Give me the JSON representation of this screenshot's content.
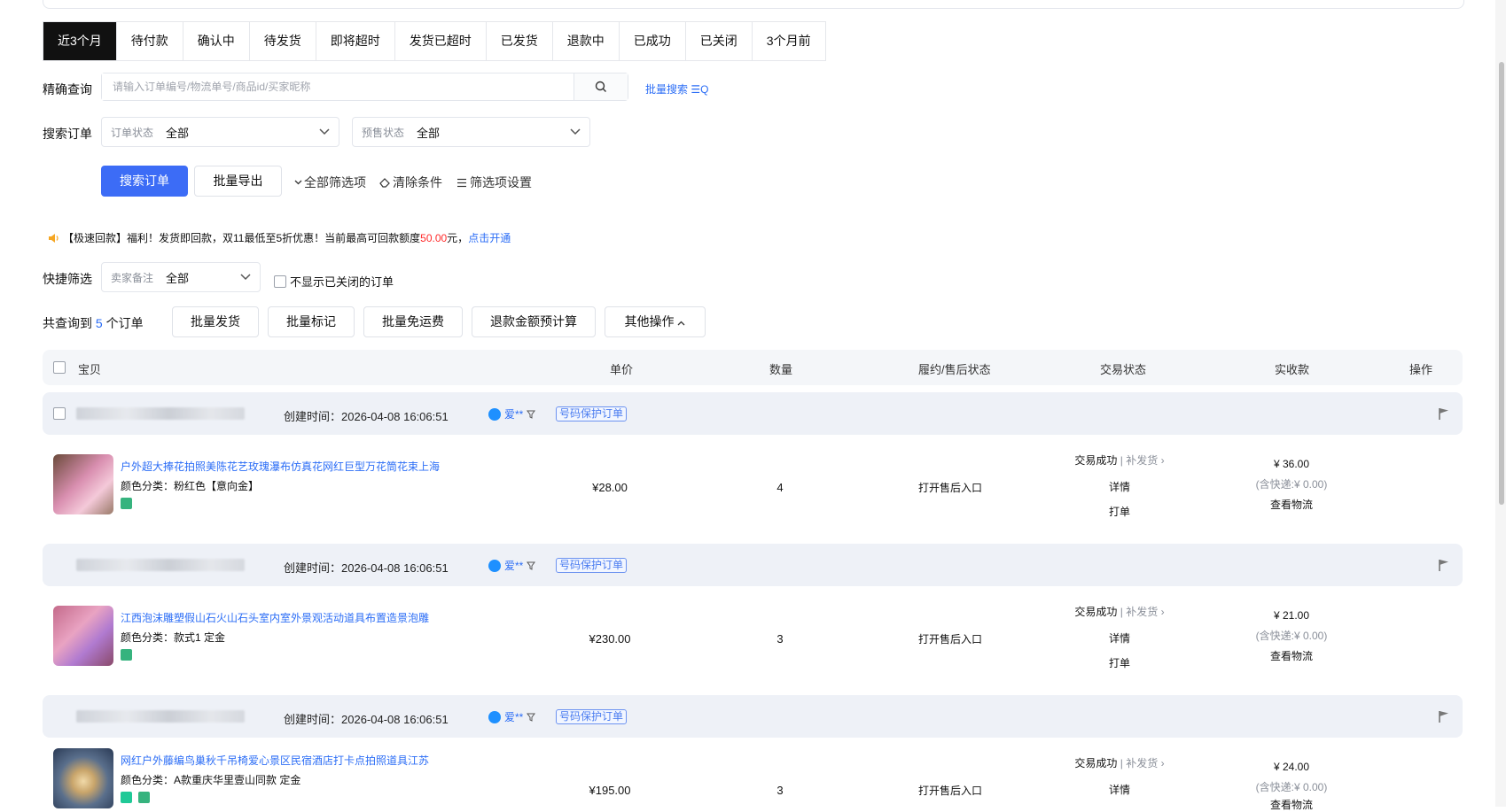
{
  "tabs": [
    "近3个月",
    "待付款",
    "确认中",
    "待发货",
    "即将超时",
    "发货已超时",
    "已发货",
    "退款中",
    "已成功",
    "已关闭",
    "3个月前"
  ],
  "exact_query": {
    "label": "精确查询",
    "placeholder": "请输入订单编号/物流单号/商品id/买家昵称",
    "batch_search": "批量搜索 ☰Q"
  },
  "search_orders": {
    "label": "搜索订单",
    "order_status": {
      "label": "订单状态",
      "value": "全部"
    },
    "presale_status": {
      "label": "预售状态",
      "value": "全部"
    }
  },
  "actions": {
    "search": "搜索订单",
    "batch_export": "批量导出",
    "all_filters": "全部筛选项",
    "clear": "清除条件",
    "filter_settings": "筛选项设置"
  },
  "notice": {
    "prefix": "【极速回款】福利！发货即回款，双11最低至5折优惠！当前最高可回款额度",
    "amount": "50.00",
    "suffix": "元，",
    "link": "点击开通"
  },
  "quick_filter": {
    "label": "快捷筛选",
    "remark": {
      "label": "卖家备注",
      "value": "全部"
    },
    "hide_closed": "不显示已关闭的订单"
  },
  "summary": {
    "prefix": "共查询到",
    "count": "5",
    "suffix": "个订单"
  },
  "bulk": {
    "ship": "批量发货",
    "mark": "批量标记",
    "free_shipping": "批量免运费",
    "refund_calc": "退款金额预计算",
    "other": "其他操作"
  },
  "table_headers": {
    "item": "宝贝",
    "price": "单价",
    "qty": "数量",
    "fulfill": "履约/售后状态",
    "trade": "交易状态",
    "received": "实收款",
    "ops": "操作"
  },
  "orders": [
    {
      "created": "创建时间：2026-04-08 16:06:51",
      "buyer": "爱**",
      "protect": "号码保护订单",
      "title": "户外超大捧花拍照美陈花艺玫瑰瀑布仿真花网红巨型万花筒花束上海",
      "spec": "颜色分类：粉红色【意向金】",
      "price": "¥28.00",
      "qty": "4",
      "after_sale": "打开售后入口",
      "status": "交易成功",
      "resend": "补发货",
      "detail": "详情",
      "print": "打单",
      "total": "¥ 36.00",
      "shipping_note": "(含快递:¥ 0.00)",
      "logistics": "查看物流"
    },
    {
      "created": "创建时间：2026-04-08 16:06:51",
      "buyer": "爱**",
      "protect": "号码保护订单",
      "title": "江西泡沫雕塑假山石火山石头室内室外景观活动道具布置造景泡雕",
      "spec": "颜色分类：款式1 定金",
      "price": "¥230.00",
      "qty": "3",
      "after_sale": "打开售后入口",
      "status": "交易成功",
      "resend": "补发货",
      "detail": "详情",
      "print": "打单",
      "total": "¥ 21.00",
      "shipping_note": "(含快递:¥ 0.00)",
      "logistics": "查看物流"
    },
    {
      "created": "创建时间：2026-04-08 16:06:51",
      "buyer": "爱**",
      "protect": "号码保护订单",
      "title": "网红户外藤编鸟巢秋千吊椅爱心景区民宿酒店打卡点拍照道具江苏",
      "spec": "颜色分类：A款重庆华里壹山同款 定金",
      "price": "¥195.00",
      "qty": "3",
      "after_sale": "打开售后入口",
      "status": "交易成功",
      "resend": "补发货",
      "detail": "详情",
      "total": "¥ 24.00",
      "shipping_note": "(含快递:¥ 0.00)",
      "logistics": "查看物流"
    }
  ]
}
